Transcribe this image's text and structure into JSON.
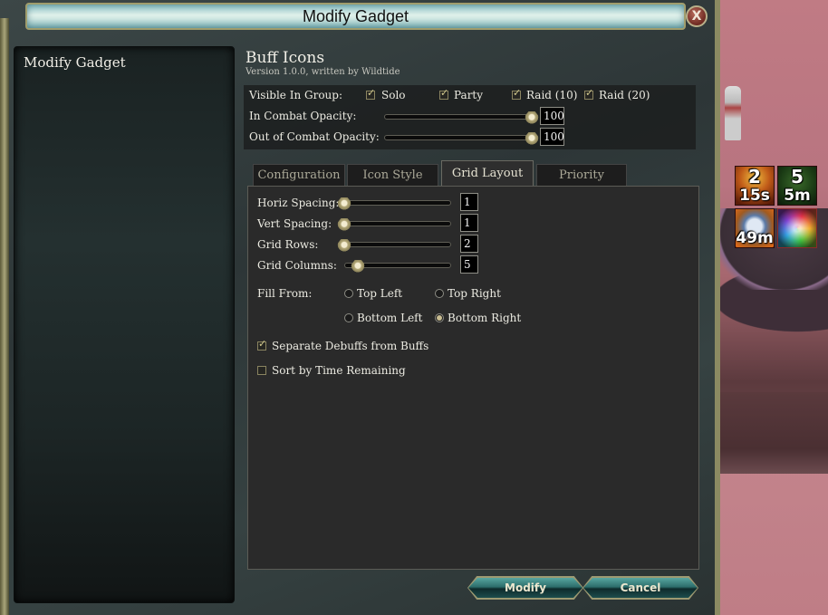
{
  "window": {
    "title": "Modify Gadget",
    "close_label": "X"
  },
  "left_panel": {
    "title": "Modify Gadget"
  },
  "addon": {
    "name": "Buff Icons",
    "subtitle": "Version 1.0.0, written by Wildtide"
  },
  "visibility": {
    "label": "Visible In Group:",
    "options": [
      {
        "label": "Solo",
        "checked": true
      },
      {
        "label": "Party",
        "checked": true
      },
      {
        "label": "Raid (10)",
        "checked": true
      },
      {
        "label": "Raid (20)",
        "checked": true
      }
    ]
  },
  "opacity": {
    "in_combat": {
      "label": "In Combat Opacity:",
      "value": "100",
      "fraction": 1.0
    },
    "out_combat": {
      "label": "Out of Combat Opacity:",
      "value": "100",
      "fraction": 1.0
    }
  },
  "tabs": [
    {
      "label": "Configuration",
      "active": false
    },
    {
      "label": "Icon Style",
      "active": false
    },
    {
      "label": "Grid Layout",
      "active": true
    },
    {
      "label": "Priority",
      "active": false
    }
  ],
  "grid_layout": {
    "sliders": [
      {
        "label": "Horiz Spacing:",
        "value": "1",
        "fraction": 0.0
      },
      {
        "label": "Vert Spacing:",
        "value": "1",
        "fraction": 0.0
      },
      {
        "label": "Grid Rows:",
        "value": "2",
        "fraction": 0.0
      },
      {
        "label": "Grid Columns:",
        "value": "5",
        "fraction": 0.08
      }
    ],
    "fill_from": {
      "label": "Fill From:",
      "options": [
        {
          "label": "Top Left",
          "selected": false
        },
        {
          "label": "Top Right",
          "selected": false
        },
        {
          "label": "Bottom Left",
          "selected": false
        },
        {
          "label": "Bottom Right",
          "selected": true
        }
      ]
    },
    "separate_debuffs": {
      "label": "Separate Debuffs from Buffs",
      "checked": true
    },
    "sort_by_time": {
      "label": "Sort by Time Remaining",
      "checked": false
    }
  },
  "buttons": {
    "modify": "Modify",
    "cancel": "Cancel"
  },
  "buff_icons": [
    {
      "stack": "2",
      "time": "15s"
    },
    {
      "stack": "5",
      "time": "5m"
    },
    {
      "stack": "",
      "time": "49m"
    },
    {
      "stack": "",
      "time": ""
    }
  ]
}
